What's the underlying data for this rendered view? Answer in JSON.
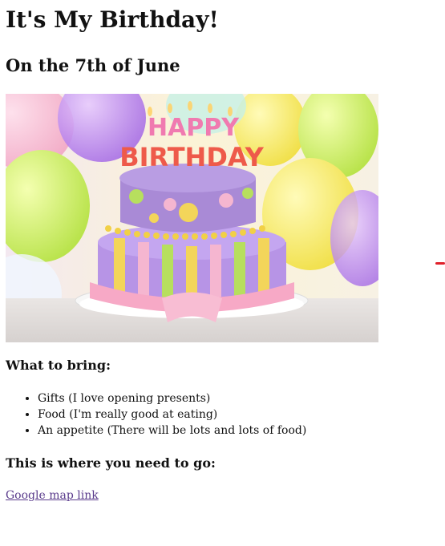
{
  "page": {
    "title": "It's My Birthday!",
    "subtitle": "On the 7th of June"
  },
  "hero_image": {
    "icon": "birthday-cake-image",
    "candle_text_top": "HAPPY",
    "candle_text_bottom": "BIRTHDAY"
  },
  "bring": {
    "heading": "What to bring:",
    "items": [
      "Gifts (I love opening presents)",
      "Food (I'm really good at eating)",
      "An appetite (There will be lots and lots of food)"
    ]
  },
  "location": {
    "heading": "This is where you need to go:",
    "link_label": "Google map link"
  },
  "colors": {
    "link": "#5a3b8c",
    "accent_mark": "#e0202a"
  }
}
